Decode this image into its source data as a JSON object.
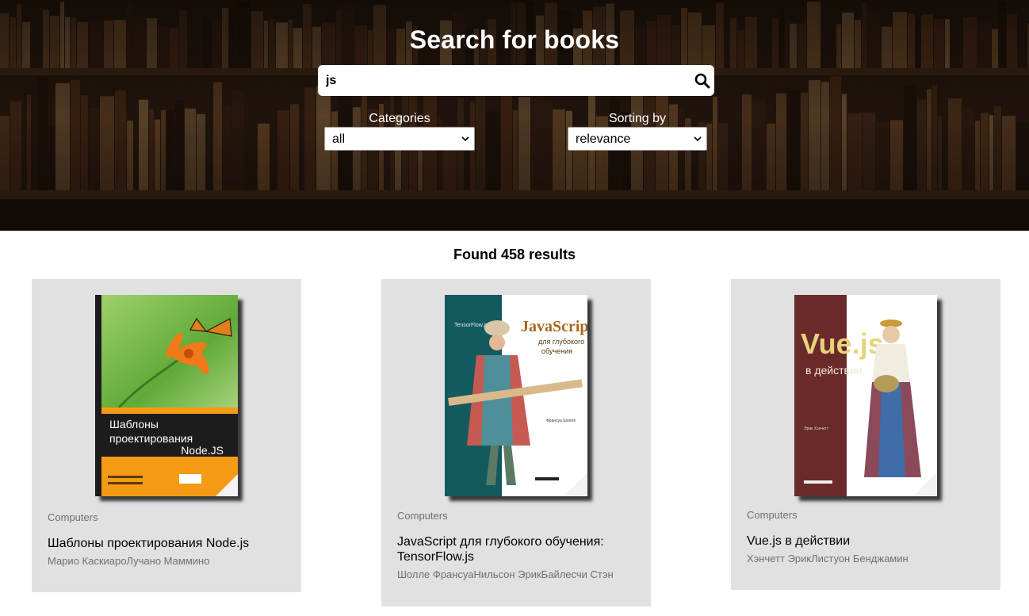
{
  "hero": {
    "title": "Search for books",
    "search": {
      "value": "js",
      "icon": "search-icon"
    },
    "categories": {
      "label": "Categories",
      "selected": "all"
    },
    "sorting": {
      "label": "Sorting by",
      "selected": "relevance"
    }
  },
  "results": {
    "count_text": "Found 458 results",
    "books": [
      {
        "category": "Computers",
        "title": "Шаблоны проектирования Node.js",
        "authors": "Марио КаскиароЛучано Маммино",
        "cover_text": [
          "Шаблоны",
          "проектирования",
          "Node.JS"
        ]
      },
      {
        "category": "Computers",
        "title": "JavaScript для глубокого обучения: TensorFlow.js",
        "authors": "Шолле ФрансуаНильсон ЭрикБайлесчи Стэн",
        "cover_text": [
          "JavaScript",
          "для глубокого",
          "обучения"
        ]
      },
      {
        "category": "Computers",
        "title": "Vue.js в действии",
        "authors": "Хэнчетт ЭрикЛистуон Бенджамин",
        "cover_text": [
          "Vue.js",
          "в действии"
        ]
      }
    ]
  },
  "colors": {
    "card_bg": "#e1e1e1",
    "muted_text": "#6f6f6f",
    "hero_overlay": "#1a0f08"
  }
}
